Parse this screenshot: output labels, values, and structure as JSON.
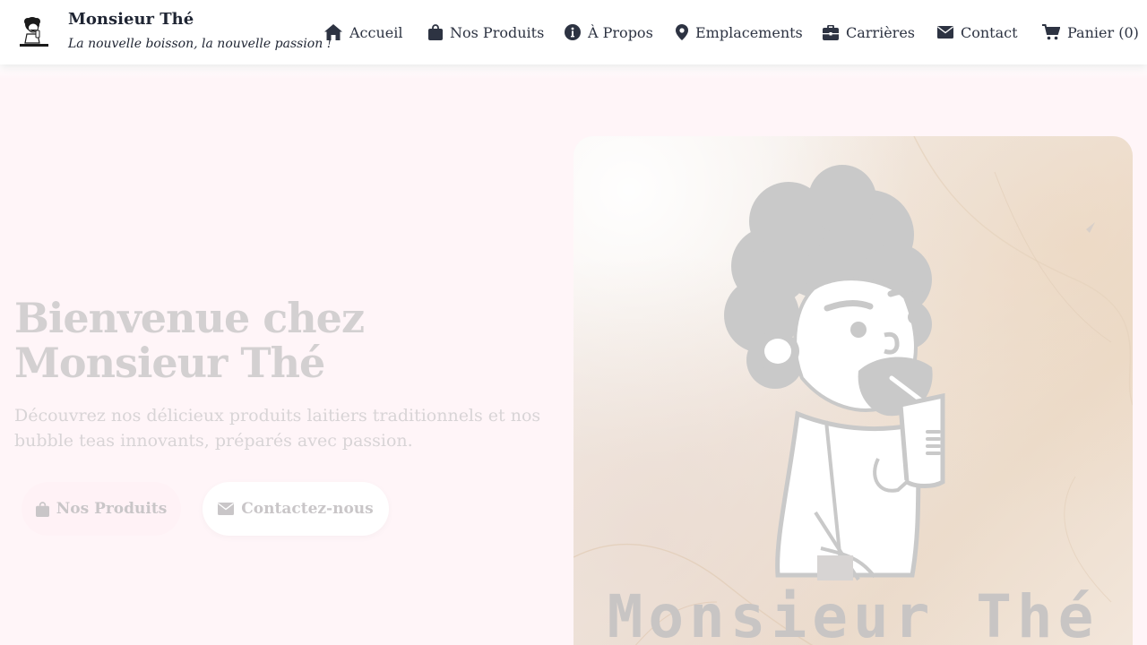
{
  "brand": {
    "name": "Monsieur Thé",
    "tagline": "La nouvelle boisson, la nouvelle passion !"
  },
  "nav": {
    "home": "Accueil",
    "products": "Nos Produits",
    "about": "À Propos",
    "locations": "Emplacements",
    "careers": "Carrières",
    "contact": "Contact",
    "cart": "Panier (0)"
  },
  "hero": {
    "title": "Bienvenue chez Monsieur Thé",
    "subtitle": "Découvrez nos délicieux produits laitiers traditionnels et nos bubble teas innovants, préparés avec passion.",
    "primary_button": "Nos Produits",
    "secondary_button": "Contactez-nous",
    "image_wordmark": "Monsieur Thé"
  },
  "icons": {
    "home": "home-icon",
    "products": "shopping-bag-icon",
    "about": "info-icon",
    "locations": "map-marker-icon",
    "careers": "briefcase-icon",
    "contact": "envelope-icon",
    "cart": "cart-icon"
  },
  "colors": {
    "nav_text": "#2d3342",
    "page_background": "#fff5f8",
    "hero_text_faded": "#d3d0d1"
  }
}
